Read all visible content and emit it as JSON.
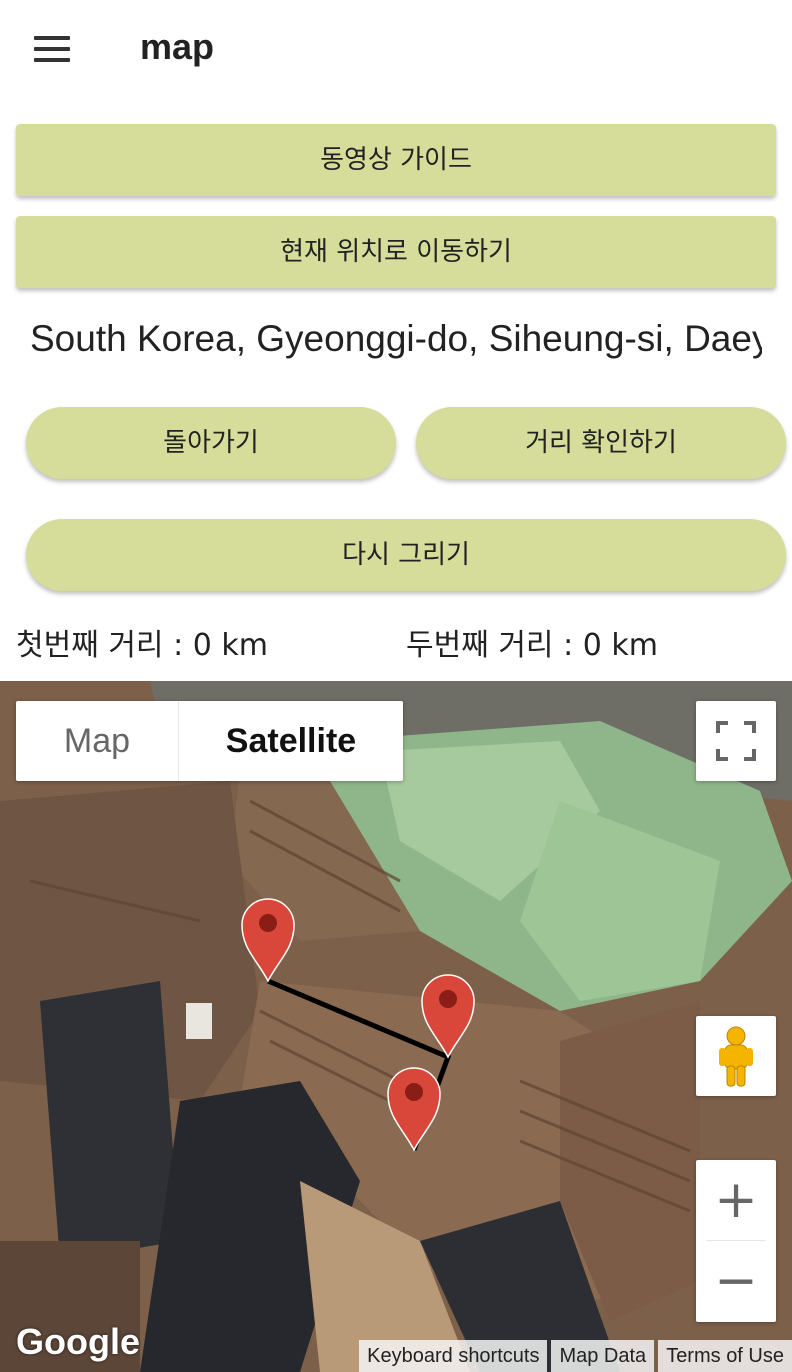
{
  "appbar": {
    "title": "map",
    "menu_icon": "hamburger-menu-icon"
  },
  "buttons": {
    "video_guide": "동영상 가이드",
    "move_to_current": "현재 위치로 이동하기",
    "back": "돌아가기",
    "check_distance": "거리 확인하기",
    "redraw": "다시 그리기"
  },
  "address": "South Korea, Gyeonggi-do, Siheung-si, Daey",
  "distances": {
    "first": "첫번째 거리 : 0 km",
    "second": "두번째 거리 : 0 km"
  },
  "map": {
    "type_map": "Map",
    "type_satellite": "Satellite",
    "selected_type": "Satellite",
    "logo": "Google",
    "attribution": {
      "keyboard": "Keyboard shortcuts",
      "map_data": "Map Data",
      "terms": "Terms of Use"
    },
    "zoom_in": "+",
    "zoom_out": "−",
    "marker_color": "#d9473a",
    "route_color": "#000000"
  },
  "colors": {
    "button_bg": "#d6dc9a"
  }
}
